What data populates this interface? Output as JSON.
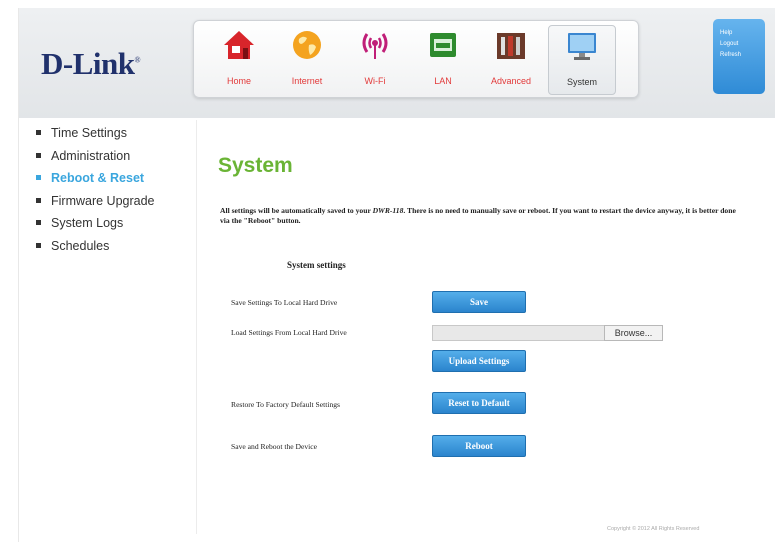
{
  "brand": {
    "logo_text": "D-Link",
    "logo_mark": "®"
  },
  "nav": [
    {
      "label": "Home",
      "icon": "home-icon"
    },
    {
      "label": "Internet",
      "icon": "globe-icon"
    },
    {
      "label": "Wi-Fi",
      "icon": "wifi-icon"
    },
    {
      "label": "LAN",
      "icon": "lan-icon"
    },
    {
      "label": "Advanced",
      "icon": "tools-icon"
    },
    {
      "label": "System",
      "icon": "computer-icon",
      "active": true
    }
  ],
  "links": {
    "help": "Help",
    "logout": "Logout",
    "refresh": "Refresh"
  },
  "sidebar": {
    "items": [
      {
        "label": "Time Settings"
      },
      {
        "label": "Administration"
      },
      {
        "label": "Reboot & Reset",
        "active": true
      },
      {
        "label": "Firmware Upgrade"
      },
      {
        "label": "System Logs"
      },
      {
        "label": "Schedules"
      }
    ]
  },
  "main": {
    "title": "System",
    "description_prefix": "All settings will be automatically saved to your ",
    "device_model": "DWR-118",
    "description_suffix": ". There is no need to manually save or reboot. If you want to restart the device anyway, it is better done via the \"Reboot\" button.",
    "section_title": "System settings",
    "save_label": "Save Settings To Local Hard Drive",
    "save_button": "Save",
    "load_label": "Load Settings From Local Hard Drive",
    "browse_button": "Browse...",
    "upload_button": "Upload Settings",
    "restore_label": "Restore To Factory Default Settings",
    "reset_button": "Reset to Default",
    "reboot_label": "Save and Reboot the Device",
    "reboot_button": "Reboot"
  },
  "footer": {
    "copyright": "Copyright © 2012  All Rights Reserved"
  },
  "colors": {
    "brand_navy": "#20316c",
    "accent_blue": "#3aa6de",
    "title_green": "#6ab435",
    "button_blue": "#3a97dc",
    "nav_label_red": "#e23a3a"
  }
}
